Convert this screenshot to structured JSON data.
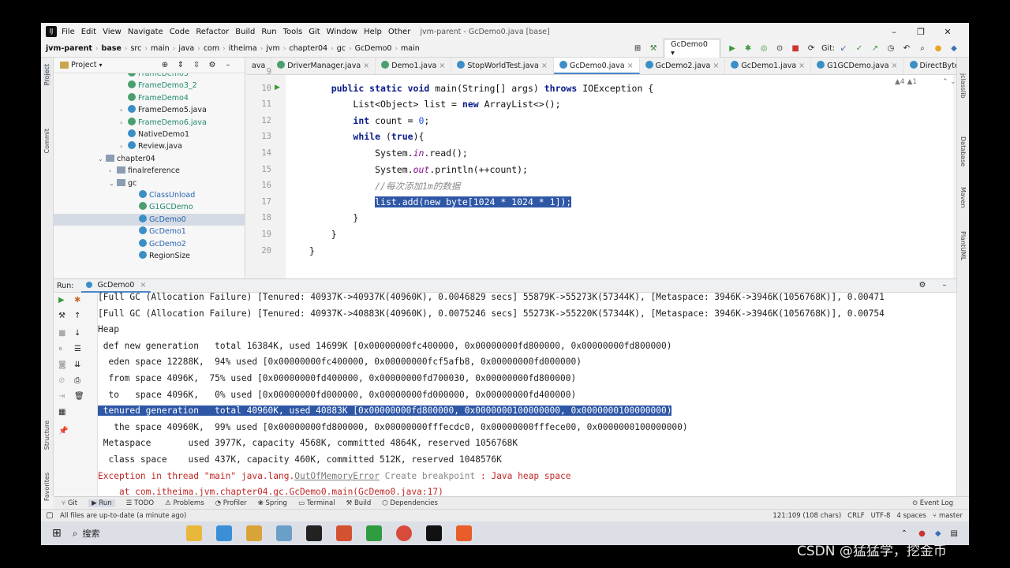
{
  "window": {
    "menu": [
      "File",
      "Edit",
      "View",
      "Navigate",
      "Code",
      "Refactor",
      "Build",
      "Run",
      "Tools",
      "Git",
      "Window",
      "Help",
      "Other"
    ],
    "title": "jvm-parent - GcDemo0.java [base]",
    "controls": [
      "–",
      "❐",
      "✕"
    ]
  },
  "breadcrumb": [
    "jvm-parent",
    "base",
    "src",
    "main",
    "java",
    "com",
    "itheima",
    "jvm",
    "chapter04",
    "gc",
    "GcDemo0",
    "main"
  ],
  "toolbar": {
    "run_config": "GcDemo0",
    "git_label": "Git:"
  },
  "project": {
    "header": "Project",
    "items": [
      {
        "label": "FrameDemo3",
        "indent": 0,
        "icon": "class",
        "color": "teal",
        "arrow": ""
      },
      {
        "label": "FrameDemo3_2",
        "indent": 0,
        "icon": "class",
        "color": "teal",
        "arrow": ""
      },
      {
        "label": "FrameDemo4",
        "indent": 0,
        "icon": "class",
        "color": "teal",
        "arrow": ""
      },
      {
        "label": "FrameDemo5.java",
        "indent": 0,
        "icon": "class",
        "color": "",
        "arrow": "›"
      },
      {
        "label": "FrameDemo6.java",
        "indent": 0,
        "icon": "class",
        "color": "teal",
        "arrow": "›"
      },
      {
        "label": "NativeDemo1",
        "indent": 0,
        "icon": "class",
        "color": "",
        "arrow": ""
      },
      {
        "label": "Review.java",
        "indent": 0,
        "icon": "class",
        "color": "",
        "arrow": "›"
      },
      {
        "label": "chapter04",
        "indent": -1,
        "icon": "package",
        "color": "",
        "arrow": "⌄"
      },
      {
        "label": "finalreference",
        "indent": 0,
        "icon": "package",
        "color": "",
        "arrow": "›"
      },
      {
        "label": "gc",
        "indent": 0,
        "icon": "package",
        "color": "",
        "arrow": "⌄"
      },
      {
        "label": "ClassUnload",
        "indent": 1,
        "icon": "class",
        "color": "blue",
        "arrow": ""
      },
      {
        "label": "G1GCDemo",
        "indent": 1,
        "icon": "class",
        "color": "teal",
        "arrow": ""
      },
      {
        "label": "GcDemo0",
        "indent": 1,
        "icon": "class",
        "color": "blue",
        "arrow": "",
        "selected": true
      },
      {
        "label": "GcDemo1",
        "indent": 1,
        "icon": "class",
        "color": "blue",
        "arrow": ""
      },
      {
        "label": "GcDemo2",
        "indent": 1,
        "icon": "class",
        "color": "blue",
        "arrow": ""
      },
      {
        "label": "RegionSize",
        "indent": 1,
        "icon": "class",
        "color": "",
        "arrow": ""
      }
    ]
  },
  "tabs": [
    "ava",
    "DriverManager.java",
    "Demo1.java",
    "StopWorldTest.java",
    "GcDemo0.java",
    "GcDemo2.java",
    "GcDemo1.java",
    "G1GCDemo.java",
    "DirectByteBuff"
  ],
  "active_tab": "GcDemo0.java",
  "editor": {
    "inspections": "▲4 ▲1",
    "lines": [
      {
        "n": "9",
        "segments": []
      },
      {
        "n": "10",
        "segments": [
          {
            "t": "    "
          },
          {
            "t": "public static void ",
            "c": "kw"
          },
          {
            "t": "main(String[] args) "
          },
          {
            "t": "throws ",
            "c": "kw"
          },
          {
            "t": "IOException {"
          }
        ]
      },
      {
        "n": "11",
        "segments": [
          {
            "t": "        List<Object> "
          },
          {
            "t": "list",
            "c": "und"
          },
          {
            "t": " = "
          },
          {
            "t": "new ",
            "c": "kw"
          },
          {
            "t": "ArrayList<>();"
          }
        ]
      },
      {
        "n": "12",
        "segments": [
          {
            "t": "        "
          },
          {
            "t": "int ",
            "c": "kw"
          },
          {
            "t": "count = "
          },
          {
            "t": "0",
            "c": "num"
          },
          {
            "t": ";"
          }
        ]
      },
      {
        "n": "13",
        "segments": [
          {
            "t": "        "
          },
          {
            "t": "while ",
            "c": "kw"
          },
          {
            "t": "("
          },
          {
            "t": "true",
            "c": "kw"
          },
          {
            "t": "){"
          }
        ]
      },
      {
        "n": "14",
        "segments": [
          {
            "t": "            System."
          },
          {
            "t": "in",
            "c": "fld"
          },
          {
            "t": ".read();"
          }
        ]
      },
      {
        "n": "15",
        "segments": [
          {
            "t": "            System."
          },
          {
            "t": "out",
            "c": "fld"
          },
          {
            "t": ".println(++count);"
          }
        ]
      },
      {
        "n": "16",
        "segments": [
          {
            "t": "            "
          },
          {
            "t": "//每次添加1m的数据",
            "c": "cm"
          }
        ]
      },
      {
        "n": "17",
        "segments": [
          {
            "t": "            "
          },
          {
            "t": "list.add(new byte[1024 * 1024 * 1]);",
            "c": "sel"
          }
        ]
      },
      {
        "n": "18",
        "segments": [
          {
            "t": "        }"
          }
        ]
      },
      {
        "n": "19",
        "segments": [
          {
            "t": "    }"
          }
        ]
      },
      {
        "n": "20",
        "segments": [
          {
            "t": "}"
          }
        ]
      }
    ]
  },
  "run": {
    "label": "Run:",
    "tab": "GcDemo0",
    "console": [
      {
        "segments": [
          {
            "t": "[Full GC (Allocation Failure) [Tenured: 40937K->40937K(40960K), 0.0046829 secs] 55879K->55273K(57344K), [Metaspace: 3946K->3946K(1056768K)], 0.00471"
          }
        ]
      },
      {
        "segments": [
          {
            "t": "[Full GC (Allocation Failure) [Tenured: 40937K->40883K(40960K), 0.0075246 secs] 55273K->55220K(57344K), [Metaspace: 3946K->3946K(1056768K)], 0.00754"
          }
        ]
      },
      {
        "segments": [
          {
            "t": "Heap"
          }
        ]
      },
      {
        "segments": [
          {
            "t": " def new generation   total 16384K, used 14699K [0x00000000fc400000, 0x00000000fd800000, 0x00000000fd800000)"
          }
        ]
      },
      {
        "segments": [
          {
            "t": "  eden space 12288K,  94% used [0x00000000fc400000, 0x00000000fcf5afb8, 0x00000000fd000000)"
          }
        ]
      },
      {
        "segments": [
          {
            "t": "  from space 4096K,  75% used [0x00000000fd400000, 0x00000000fd700030, 0x00000000fd800000)"
          }
        ]
      },
      {
        "segments": [
          {
            "t": "  to   space 4096K,   0% used [0x00000000fd000000, 0x00000000fd000000, 0x00000000fd400000)"
          }
        ]
      },
      {
        "segments": [
          {
            "t": " tenured generation   total 40960K, used 40883K [0x00000000fd800000, 0x0000000100000000, 0x0000000100000000)",
            "c": "hl"
          }
        ]
      },
      {
        "segments": [
          {
            "t": "   the space 40960K,  99% used [0x00000000fd800000, 0x00000000fffecdc0, 0x00000000fffece00, 0x0000000100000000)"
          }
        ]
      },
      {
        "segments": [
          {
            "t": " Metaspace       used 3977K, capacity 4568K, committed 4864K, reserved 1056768K"
          }
        ]
      },
      {
        "segments": [
          {
            "t": "  class space    used 437K, capacity 460K, committed 512K, reserved 1048576K"
          }
        ]
      },
      {
        "segments": [
          {
            "t": "Exception in thread \"main\" java.lang.",
            "c": "err"
          },
          {
            "t": "OutOfMemoryError",
            "c": "lnk"
          },
          {
            "t": " Create breakpoint",
            "c": "gray"
          },
          {
            "t": " : Java heap space",
            "c": "err"
          }
        ]
      },
      {
        "segments": [
          {
            "t": "    at com.itheima.jvm.chapter04.gc.GcDemo0.main(GcDemo0.java:17)",
            "c": "err"
          }
        ]
      }
    ]
  },
  "bottom_tabs": [
    "Git",
    "Run",
    "TODO",
    "Problems",
    "Profiler",
    "Spring",
    "Terminal",
    "Build",
    "Dependencies"
  ],
  "event_log": "Event Log",
  "status": {
    "message": "All files are up-to-date (a minute ago)",
    "position": "121:109 (108 chars)",
    "line_sep": "CRLF",
    "encoding": "UTF-8",
    "indent": "4 spaces",
    "branch": "master"
  },
  "taskbar": {
    "search": "搜索"
  },
  "watermark": "CSDN @猛猛学，挖金币",
  "colors": {
    "accent": "#4a88c7",
    "selection": "#2e57a6",
    "error": "#c02828"
  }
}
